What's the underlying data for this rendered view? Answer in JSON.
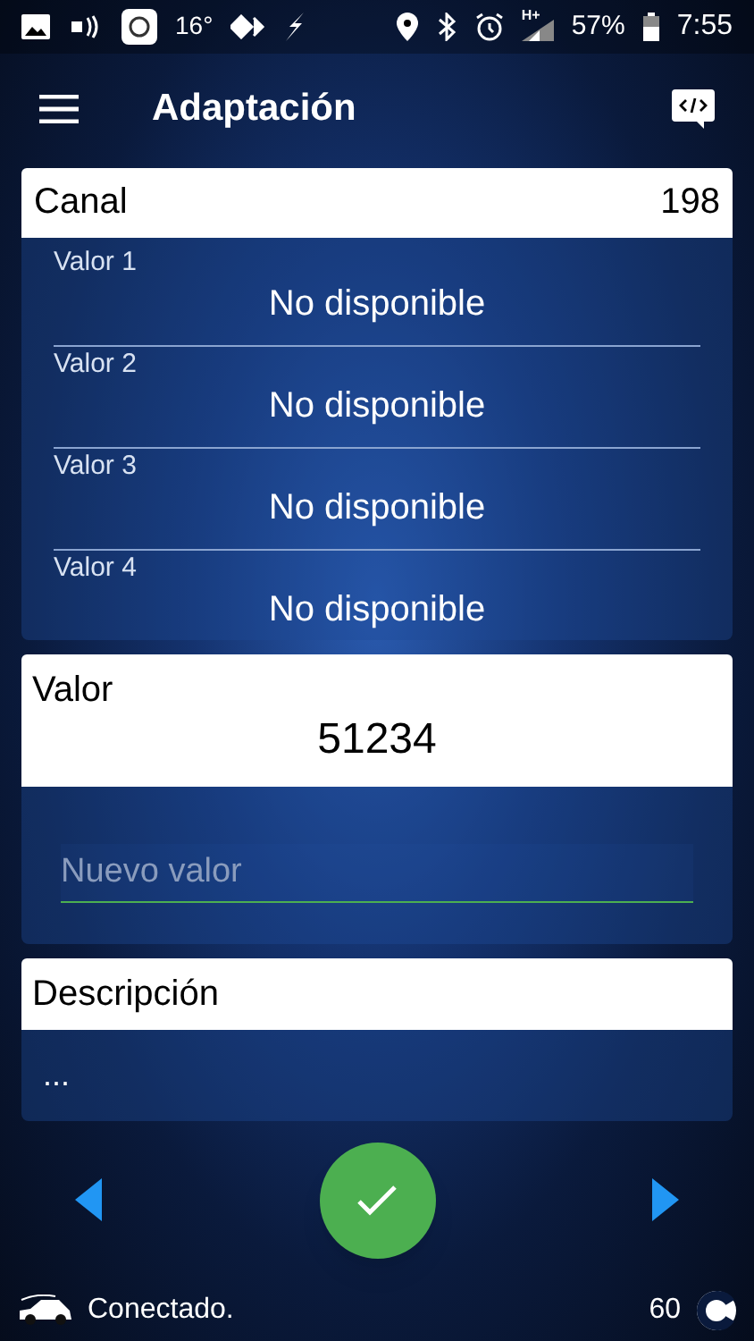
{
  "status_bar": {
    "temperature": "16°",
    "network": "H+",
    "battery": "57%",
    "time": "7:55"
  },
  "app_bar": {
    "title": "Adaptación"
  },
  "channel": {
    "label": "Canal",
    "value": "198"
  },
  "values": [
    {
      "label": "Valor 1",
      "value": "No disponible"
    },
    {
      "label": "Valor 2",
      "value": "No disponible"
    },
    {
      "label": "Valor 3",
      "value": "No disponible"
    },
    {
      "label": "Valor 4",
      "value": "No disponible"
    }
  ],
  "current": {
    "label": "Valor",
    "value": "51234"
  },
  "new_value": {
    "placeholder": "Nuevo valor"
  },
  "description": {
    "label": "Descripción",
    "text": "..."
  },
  "footer": {
    "status": "Conectado.",
    "count": "60"
  }
}
